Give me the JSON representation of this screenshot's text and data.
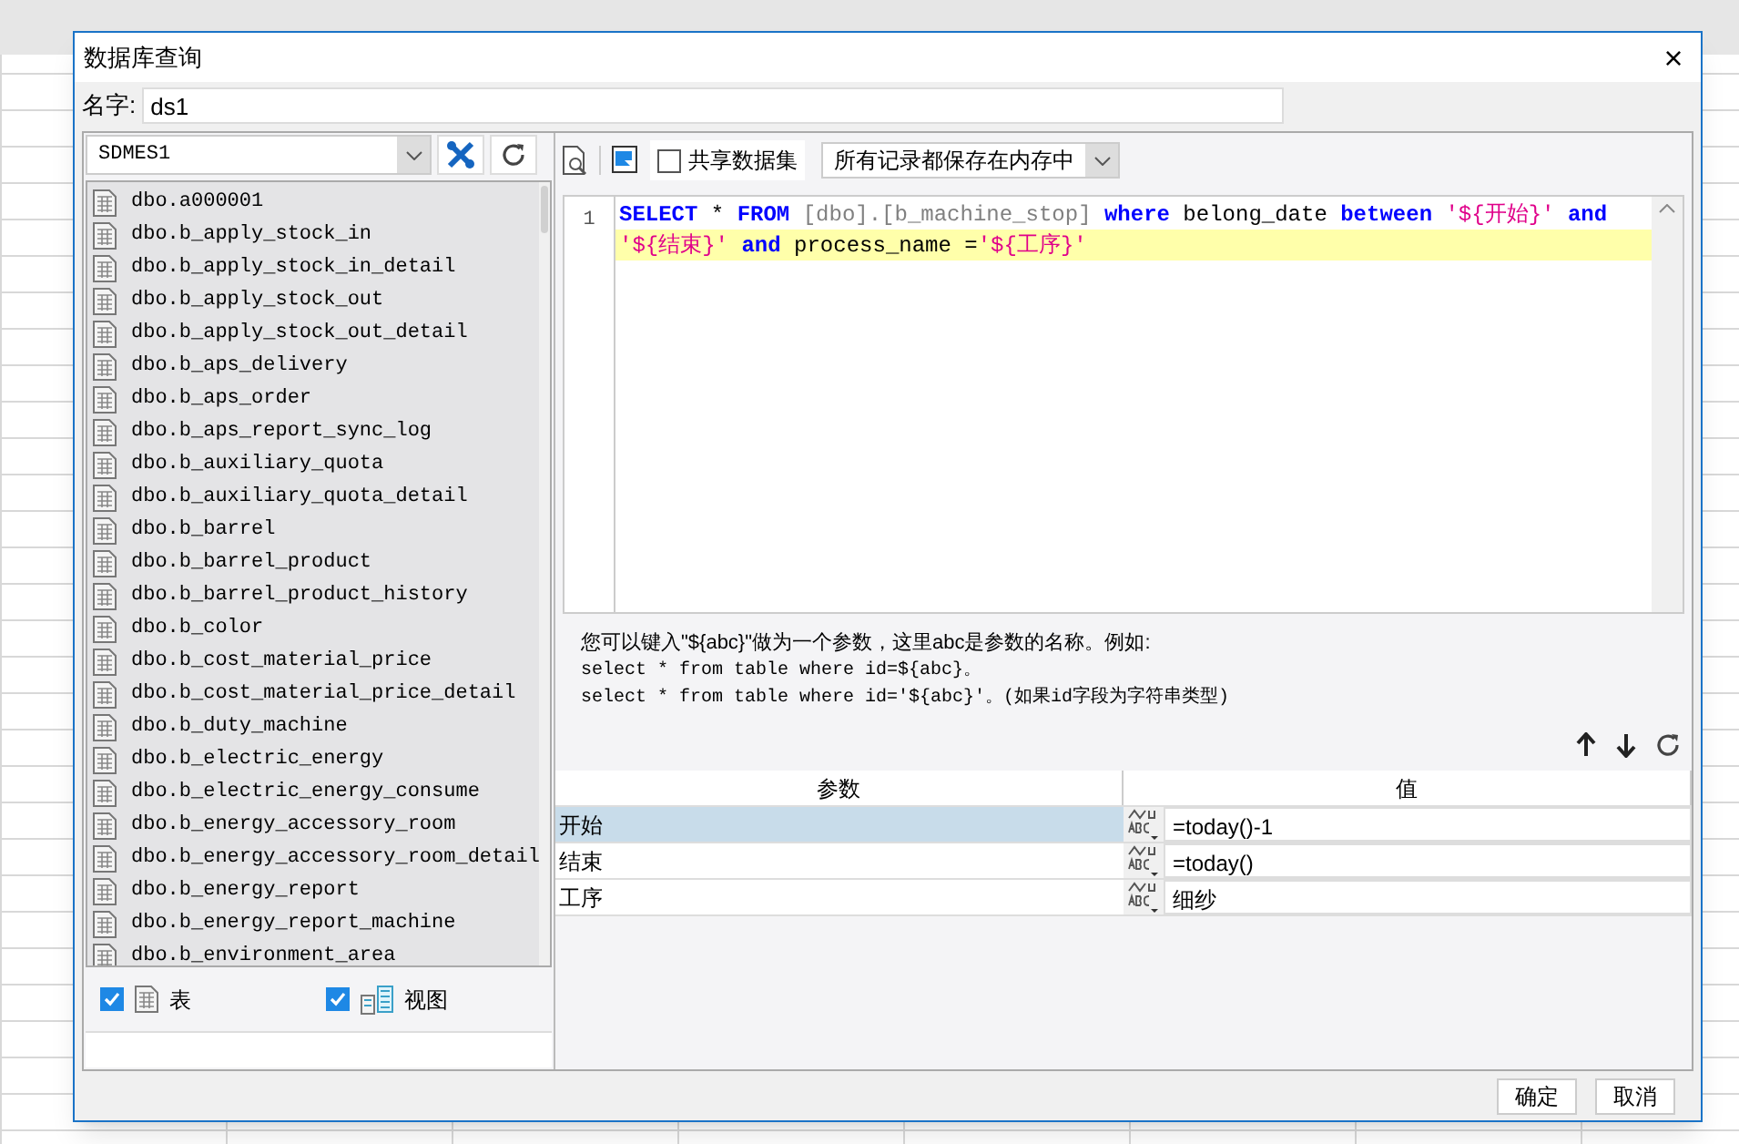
{
  "window": {
    "title": "数据库查询",
    "close": "×"
  },
  "name_field": {
    "label": "名字:",
    "value": "ds1"
  },
  "connection": {
    "value": "SDMES1"
  },
  "tables": [
    {
      "name": "dbo.a000001"
    },
    {
      "name": "dbo.b_apply_stock_in"
    },
    {
      "name": "dbo.b_apply_stock_in_detail"
    },
    {
      "name": "dbo.b_apply_stock_out"
    },
    {
      "name": "dbo.b_apply_stock_out_detail"
    },
    {
      "name": "dbo.b_aps_delivery"
    },
    {
      "name": "dbo.b_aps_order"
    },
    {
      "name": "dbo.b_aps_report_sync_log"
    },
    {
      "name": "dbo.b_auxiliary_quota"
    },
    {
      "name": "dbo.b_auxiliary_quota_detail"
    },
    {
      "name": "dbo.b_barrel"
    },
    {
      "name": "dbo.b_barrel_product"
    },
    {
      "name": "dbo.b_barrel_product_history"
    },
    {
      "name": "dbo.b_color"
    },
    {
      "name": "dbo.b_cost_material_price"
    },
    {
      "name": "dbo.b_cost_material_price_detail"
    },
    {
      "name": "dbo.b_duty_machine"
    },
    {
      "name": "dbo.b_electric_energy"
    },
    {
      "name": "dbo.b_electric_energy_consume"
    },
    {
      "name": "dbo.b_energy_accessory_room"
    },
    {
      "name": "dbo.b_energy_accessory_room_detail"
    },
    {
      "name": "dbo.b_energy_report"
    },
    {
      "name": "dbo.b_energy_report_machine"
    },
    {
      "name": "dbo.b_environment_area"
    }
  ],
  "filters": [
    {
      "label": "表",
      "checked": true,
      "kind": "table"
    },
    {
      "label": "视图",
      "checked": true,
      "kind": "view"
    }
  ],
  "toolbar": {
    "share": {
      "label": "共享数据集",
      "checked": false
    },
    "storage": {
      "value": "所有记录都保存在内存中"
    }
  },
  "editor": {
    "line_number": "1",
    "rows": [
      {
        "current": false,
        "tokens": [
          {
            "kind": "keyword",
            "text": "SELECT"
          },
          {
            "kind": "plain",
            "text": " * "
          },
          {
            "kind": "keyword",
            "text": "FROM"
          },
          {
            "kind": "ident",
            "text": " [dbo].[b_machine_stop] "
          },
          {
            "kind": "keyword",
            "text": "where"
          },
          {
            "kind": "plain",
            "text": " belong_date "
          },
          {
            "kind": "keyword",
            "text": "between"
          },
          {
            "kind": "string",
            "text": " '${开始}' "
          },
          {
            "kind": "keyword",
            "text": "and"
          }
        ]
      },
      {
        "current": true,
        "tokens": [
          {
            "kind": "string",
            "text": "'${结束}' "
          },
          {
            "kind": "keyword",
            "text": "and"
          },
          {
            "kind": "plain",
            "text": " process_name ="
          },
          {
            "kind": "string",
            "text": "'${工序}'"
          }
        ]
      }
    ]
  },
  "hint": {
    "intro": "您可以键入\"${abc}\"做为一个参数，这里abc是参数的名称。例如:",
    "examples": [
      "select * from table where id=${abc}。",
      "select * from table where id='${abc}'。(如果id字段为字符串类型)"
    ]
  },
  "params": {
    "columns": [
      "参数",
      "值"
    ],
    "rows": [
      {
        "name": "开始",
        "value": "=today()-1",
        "selected": true
      },
      {
        "name": "结束",
        "value": "=today()",
        "selected": false
      },
      {
        "name": "工序",
        "value": "细纱",
        "selected": false
      }
    ]
  },
  "buttons": [
    "确定",
    "取消"
  ]
}
